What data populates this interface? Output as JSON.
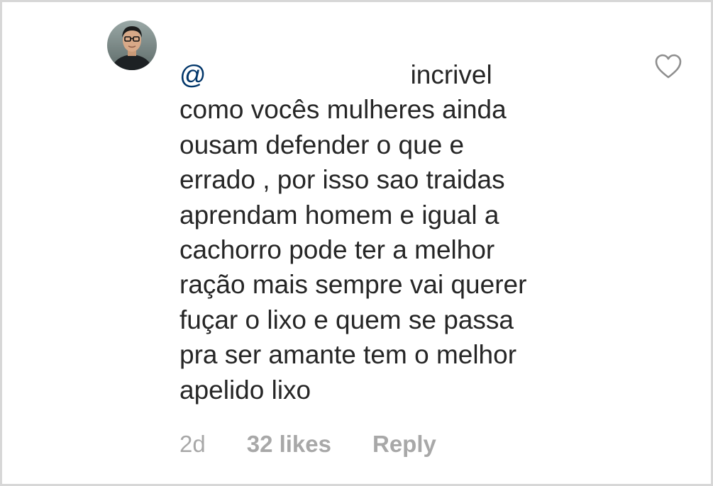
{
  "comment": {
    "mention_prefix": "@",
    "lines": [
      "incrivel",
      "como vocês  mulheres ainda",
      "ousam defender o que e",
      "errado , por isso sao traidas",
      "aprendam homem e igual a",
      "cachorro pode ter a melhor",
      "ração mais sempre vai querer",
      "fuçar o lixo e quem se passa",
      "pra ser amante tem o melhor",
      "apelido lixo"
    ]
  },
  "meta": {
    "time": "2d",
    "likes": "32 likes",
    "reply": "Reply"
  },
  "icons": {
    "like": "heart-outline-icon",
    "avatar": "user-avatar"
  },
  "colors": {
    "text": "#262626",
    "mention": "#003569",
    "meta": "#a8a8a8",
    "border": "#d7d7d7"
  }
}
